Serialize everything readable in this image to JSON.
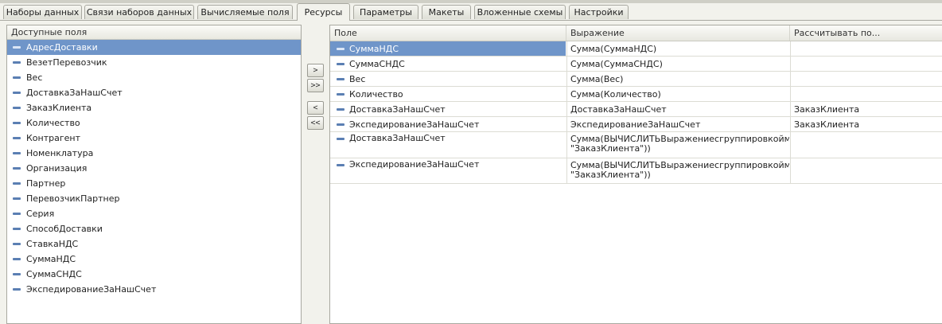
{
  "tabs": [
    {
      "label": "Наборы данных"
    },
    {
      "label": "Связи наборов данных"
    },
    {
      "label": "Вычисляемые поля"
    },
    {
      "label": "Ресурсы",
      "active": true
    },
    {
      "label": "Параметры"
    },
    {
      "label": "Макеты"
    },
    {
      "label": "Вложенные схемы"
    },
    {
      "label": "Настройки"
    }
  ],
  "available_fields": {
    "header": "Доступные поля",
    "items": [
      "АдресДоставки",
      "ВезетПеревозчик",
      "Вес",
      "ДоставкаЗаНашСчет",
      "ЗаказКлиента",
      "Количество",
      "Контрагент",
      "Номенклатура",
      "Организация",
      "Партнер",
      "ПеревозчикПартнер",
      "Серия",
      "СпособДоставки",
      "СтавкаНДС",
      "СуммаНДС",
      "СуммаСНДС",
      "ЭкспедированиеЗаНашСчет"
    ],
    "selected_index": 0
  },
  "move_buttons": {
    "add": ">",
    "add_all": ">>",
    "remove": "<",
    "remove_all": "<<"
  },
  "resources": {
    "columns": [
      "Поле",
      "Выражение",
      "Рассчитывать по..."
    ],
    "rows": [
      {
        "field": "СуммаНДС",
        "expression": [
          "Сумма(СуммаНДС)"
        ],
        "calc_by": ""
      },
      {
        "field": "СуммаСНДС",
        "expression": [
          "Сумма(СуммаСНДС)"
        ],
        "calc_by": ""
      },
      {
        "field": "Вес",
        "expression": [
          "Сумма(Вес)"
        ],
        "calc_by": ""
      },
      {
        "field": "Количество",
        "expression": [
          "Сумма(Количество)"
        ],
        "calc_by": ""
      },
      {
        "field": "ДоставкаЗаНашСчет",
        "expression": [
          "ДоставкаЗаНашСчет"
        ],
        "calc_by": "ЗаказКлиента"
      },
      {
        "field": "ЭкспедированиеЗаНашСчет",
        "expression": [
          "ЭкспедированиеЗаНашСчет"
        ],
        "calc_by": "ЗаказКлиента"
      },
      {
        "field": "ДоставкаЗаНашСчет",
        "expression": [
          "Сумма(ВЫЧИСЛИТЬВыражениесгруппировкоймас...",
          " \"ЗаказКлиента\"))"
        ],
        "calc_by": ""
      },
      {
        "field": "ЭкспедированиеЗаНашСчет",
        "expression": [
          "Сумма(ВЫЧИСЛИТЬВыражениесгруппировкоймас...",
          " \"ЗаказКлиента\"))"
        ],
        "calc_by": ""
      }
    ],
    "selected_index": 0
  },
  "colors": {
    "selection": "#6f95c9",
    "field_icon": "#5b7fb3",
    "background": "#f2f2ec"
  }
}
